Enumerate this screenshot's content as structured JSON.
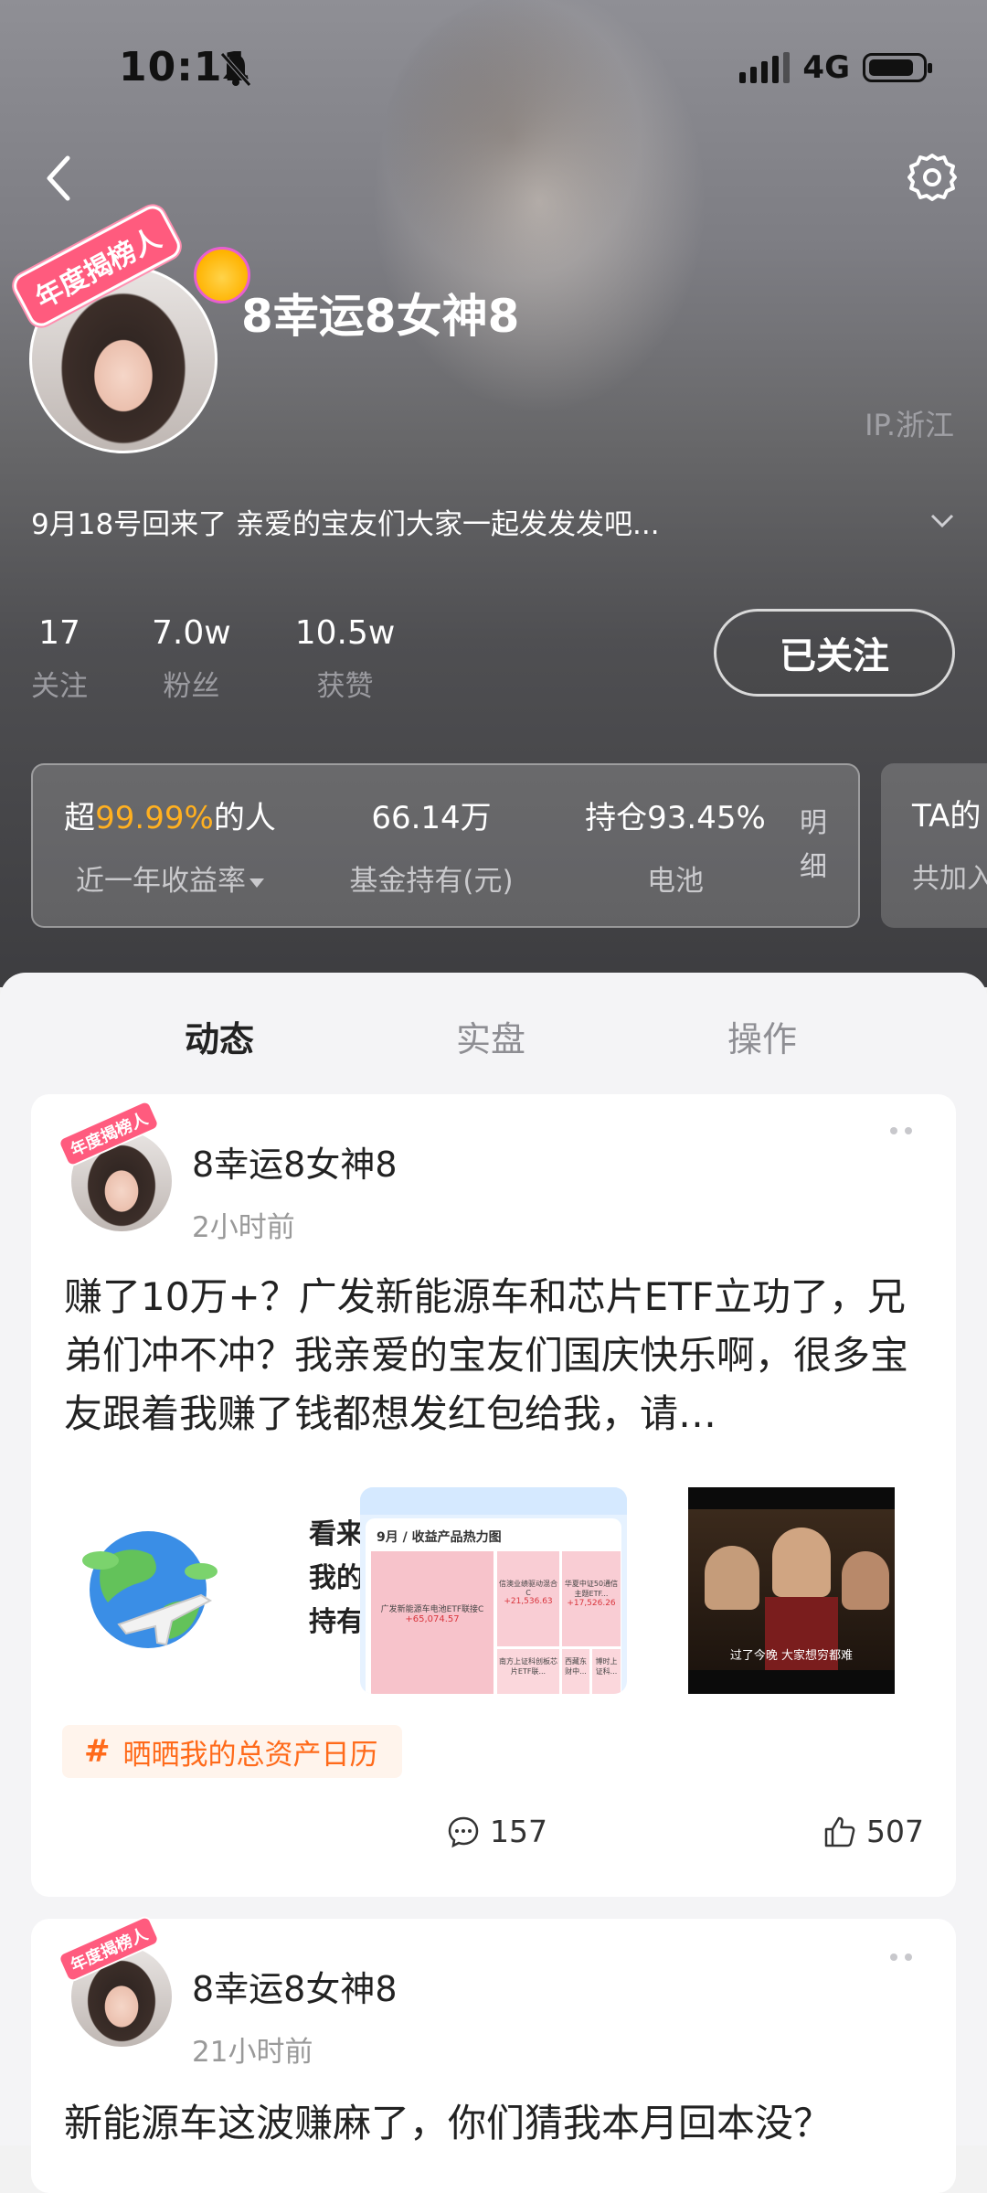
{
  "status_bar": {
    "time": "10:11",
    "network": "4G"
  },
  "profile": {
    "name": "8幸运8女神8",
    "badge": "年度揭榜人",
    "ip": "IP.浙江",
    "bio": "9月18号回来了 亲爱的宝友们大家一起发发发吧...",
    "stats": [
      {
        "value": "17",
        "label": "关注"
      },
      {
        "value": "7.0w",
        "label": "粉丝"
      },
      {
        "value": "10.5w",
        "label": "获赞"
      }
    ],
    "follow_button": "已关注"
  },
  "performance": {
    "rank_prefix": "超",
    "rank_value": "99.99%",
    "rank_suffix": "的人",
    "rank_label": "近一年收益率",
    "holding_value": "66.14万",
    "holding_label": "基金持有(元)",
    "position_value": "持仓93.45%",
    "position_label": "电池",
    "detail_label": "明细",
    "side_card_title": "TA的",
    "side_card_sub": "共加入"
  },
  "tabs": [
    {
      "label": "动态",
      "active": true
    },
    {
      "label": "实盘",
      "active": false
    },
    {
      "label": "操作",
      "active": false
    }
  ],
  "posts": [
    {
      "author": "8幸运8女神8",
      "time": "2小时前",
      "text": "赚了10万+？广发新能源车和芯片ETF立功了，兄弟们冲不冲？我亲爱的宝友们国庆快乐啊，很多宝友跟着我赚了钱都想发红包给我，请…",
      "globe_caption": [
        "看来",
        "我的",
        "持有"
      ],
      "heatmap": {
        "title": "9月 / 收益产品热力图",
        "cells": [
          {
            "name": "广发新能源车电池ETF联接C",
            "value": "+65,074.57"
          },
          {
            "name": "信澳业绩驱动混合C",
            "value": "+21,536.63"
          },
          {
            "name": "华夏中证50通信主题ETF...",
            "value": "+17,526.26"
          },
          {
            "name": "南方上证科创板芯片ETF联...",
            "value": ""
          },
          {
            "name": "西藏东财中...",
            "value": ""
          },
          {
            "name": "博时上证科...",
            "value": ""
          }
        ]
      },
      "movie_subtitle": "过了今晚 大家想穷都难",
      "topic": "晒晒我的总资产日历",
      "comments": "157",
      "likes": "507"
    },
    {
      "author": "8幸运8女神8",
      "time": "21小时前",
      "text": "新能源车这波赚麻了，你们猜我本月回本没？"
    }
  ],
  "colors": {
    "accent_orange": "#ff6a1a",
    "rank_highlight": "#ffb020"
  }
}
